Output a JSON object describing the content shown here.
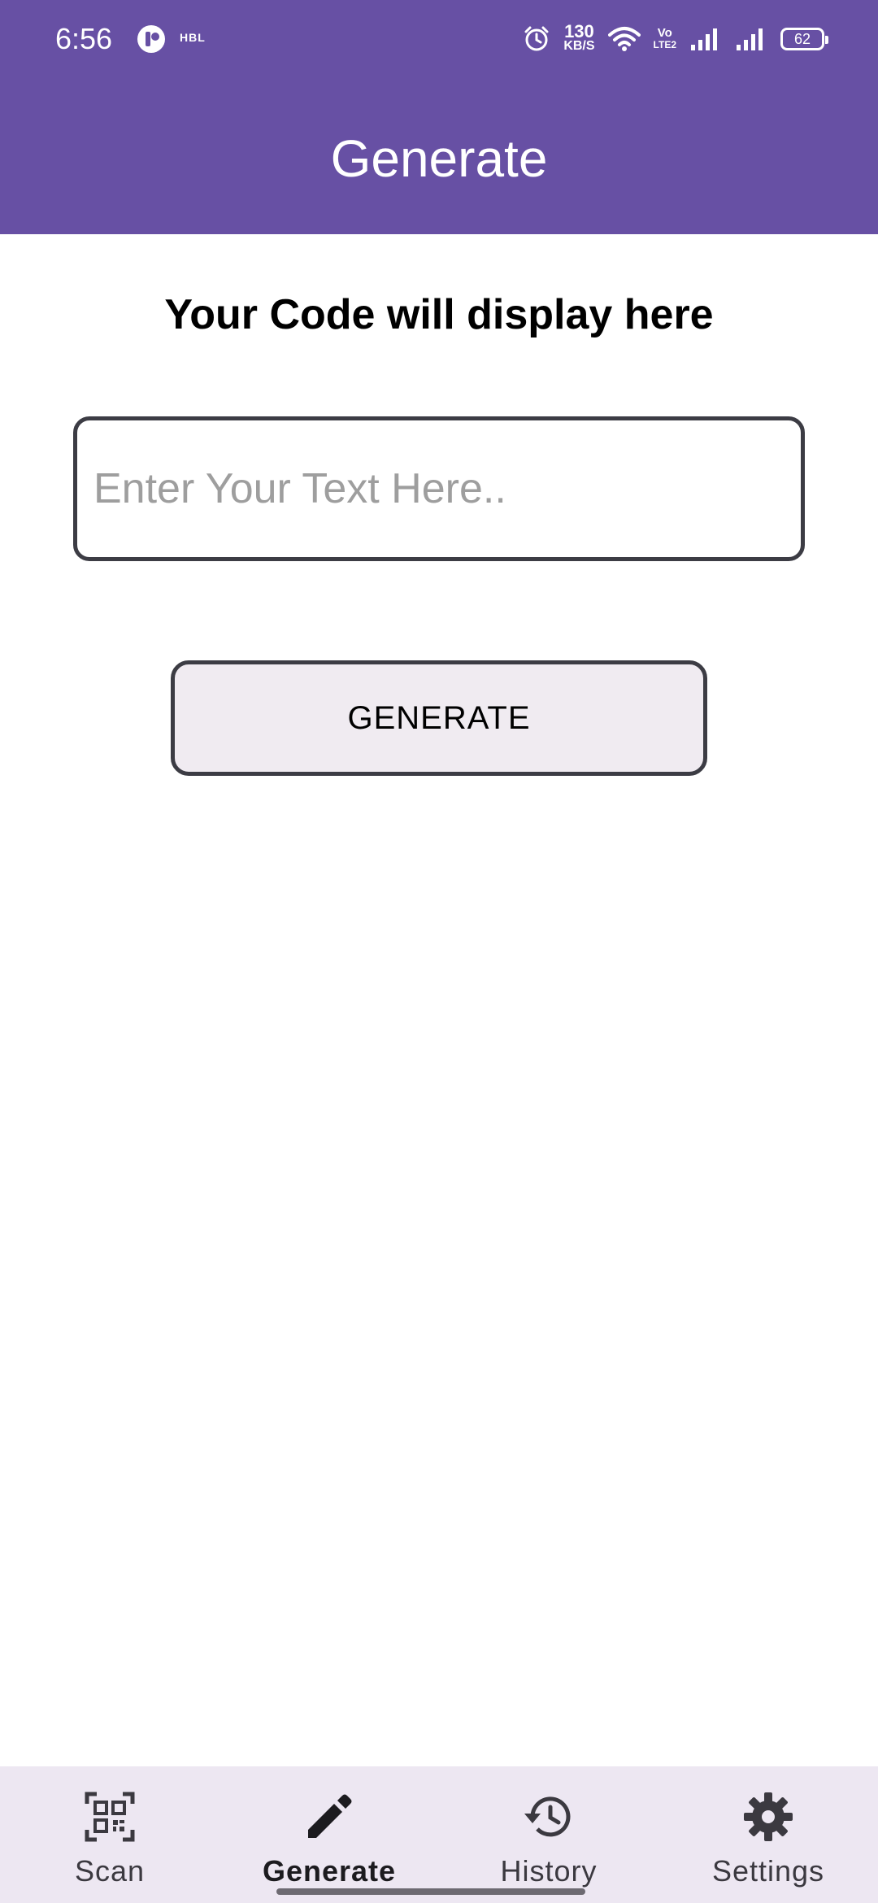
{
  "status_bar": {
    "time": "6:56",
    "carrier": "HBL",
    "net_speed_value": "130",
    "net_speed_unit": "KB/S",
    "volte_top": "Vo",
    "volte_bottom": "LTE2",
    "battery": "62"
  },
  "header": {
    "title": "Generate"
  },
  "main": {
    "code_placeholder": "Your Code will display here",
    "input_placeholder": "Enter Your Text Here..",
    "input_value": "",
    "generate_label": "GENERATE"
  },
  "nav": {
    "items": [
      {
        "label": "Scan",
        "icon": "qr-code-scanner-icon",
        "active": false
      },
      {
        "label": "Generate",
        "icon": "pencil-icon",
        "active": true
      },
      {
        "label": "History",
        "icon": "history-icon",
        "active": false
      },
      {
        "label": "Settings",
        "icon": "gear-icon",
        "active": false
      }
    ]
  },
  "colors": {
    "primary": "#6750a4",
    "nav_background": "#ede7f2",
    "button_background": "#f0ebf1"
  }
}
